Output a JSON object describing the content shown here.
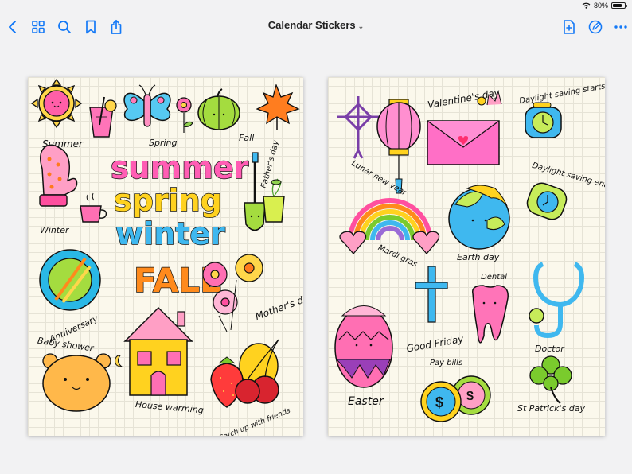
{
  "status": {
    "battery_text": "80%",
    "battery_level": 0.8
  },
  "toolbar": {
    "title": "Calendar Stickers",
    "icons": [
      "back-chevron-icon",
      "thumbnail-grid-icon",
      "search-icon",
      "bookmark-icon",
      "share-icon",
      "add-page-icon",
      "markup-pen-icon",
      "more-icon"
    ]
  },
  "left_page": {
    "labels": {
      "summer": "Summer",
      "spring": "Spring",
      "fall": "Fall",
      "winter": "Winter",
      "fathers_day": "Father's day",
      "anniversary": "Anniversary",
      "mothers_day": "Mother's day",
      "baby_shower": "Baby shower",
      "house_warming": "House warming",
      "catch_up": "Catch up with friends"
    },
    "big_words": [
      "summer",
      "spring",
      "winter",
      "FALL"
    ],
    "big_colors": [
      "#ff5db4",
      "#ffd21f",
      "#3fb8ef",
      "#ff8a1c"
    ]
  },
  "right_page": {
    "labels": {
      "lunar_new_year": "Lunar new year",
      "valentines_day": "Valentine's day",
      "daylight_starts": "Daylight saving starts",
      "daylight_ends": "Daylight saving ends",
      "mardi_gras": "Mardi gras",
      "earth_day": "Earth day",
      "dental": "Dental",
      "good_friday": "Good Friday",
      "doctor": "Doctor",
      "easter": "Easter",
      "pay_bills": "Pay bills",
      "st_patricks": "St Patrick's day"
    },
    "dollar": "$"
  }
}
